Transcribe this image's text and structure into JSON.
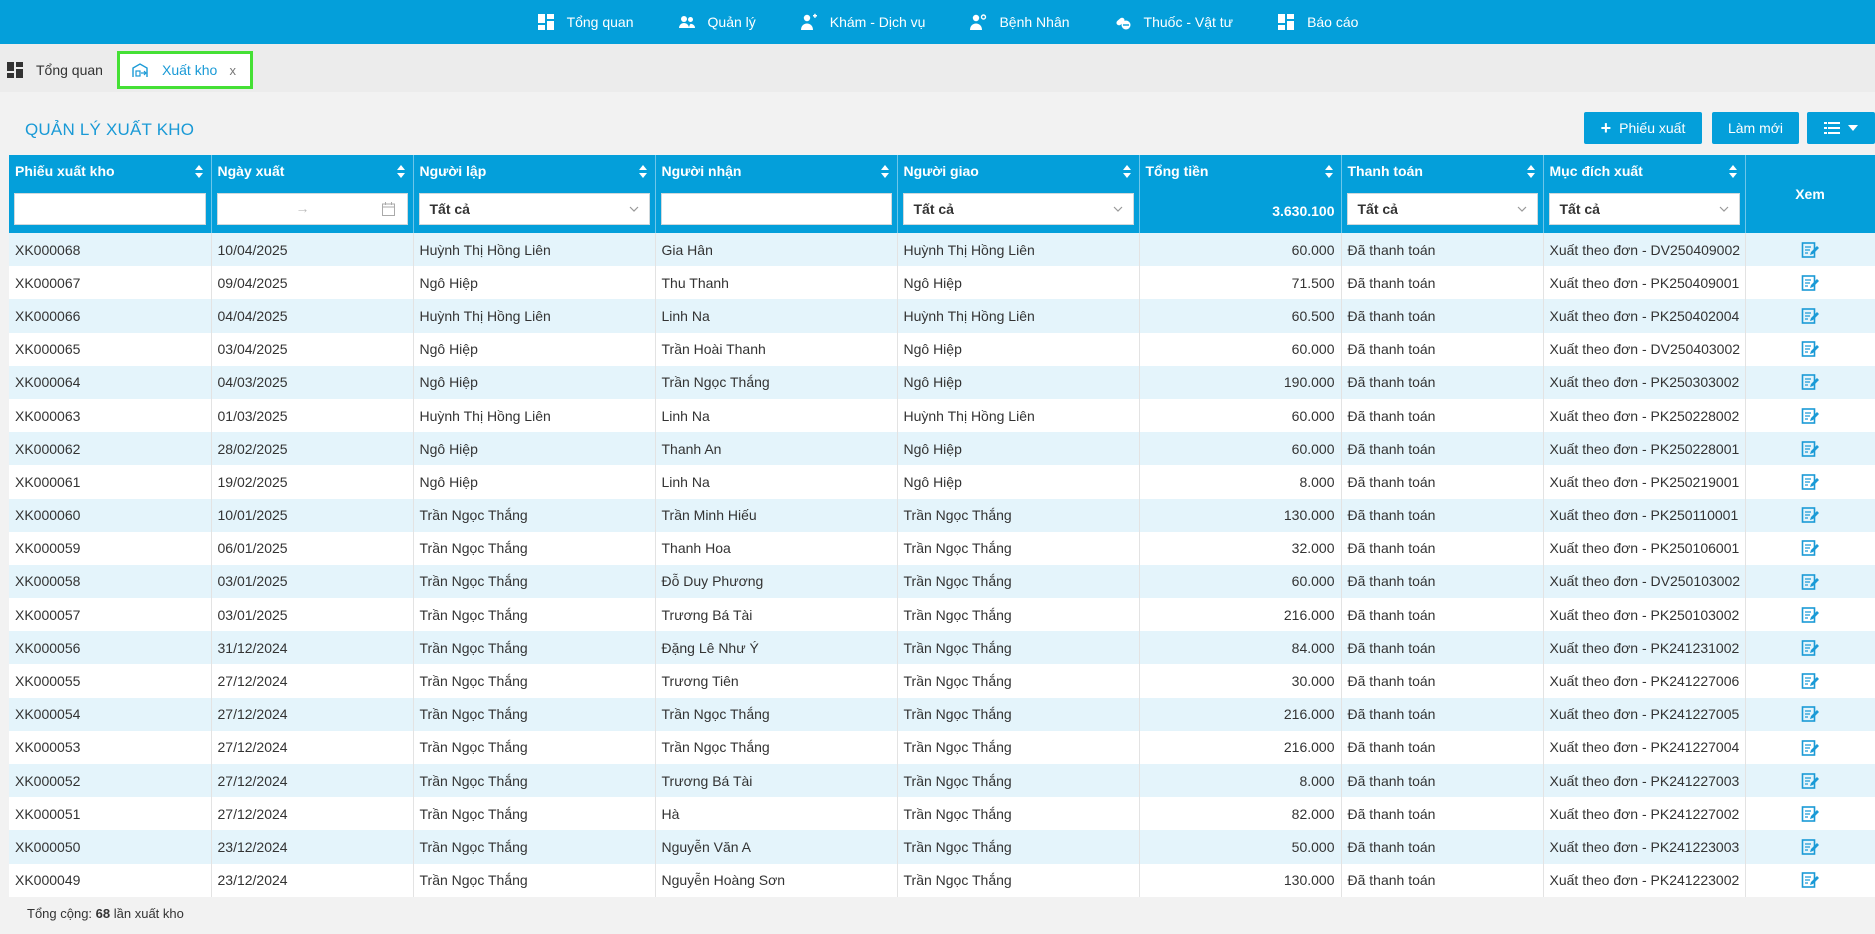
{
  "nav": {
    "items": [
      {
        "label": "Tổng quan",
        "icon": "dashboard-icon"
      },
      {
        "label": "Quản lý",
        "icon": "users-icon"
      },
      {
        "label": "Khám - Dịch vụ",
        "icon": "doctor-icon"
      },
      {
        "label": "Bệnh Nhân",
        "icon": "patient-icon"
      },
      {
        "label": "Thuốc - Vật tư",
        "icon": "medicine-icon"
      },
      {
        "label": "Báo cáo",
        "icon": "report-icon"
      }
    ]
  },
  "tabs": {
    "home": "Tổng quan",
    "active": "Xuất kho",
    "close": "x"
  },
  "panel": {
    "title": "QUẢN LÝ XUẤT KHO",
    "add_button": "Phiếu xuất",
    "refresh_button": "Làm mới"
  },
  "table": {
    "columns": [
      "Phiếu xuất kho",
      "Ngày xuất",
      "Người lập",
      "Người nhận",
      "Người giao",
      "Tổng tiền",
      "Thanh toán",
      "Mục đích xuất",
      "Xem"
    ],
    "filters": {
      "nguoi_lap": "Tất cả",
      "nguoi_giao": "Tất cả",
      "thanh_toan": "Tất cả",
      "muc_dich": "Tất cả",
      "date_separator": "→"
    },
    "total": "3.630.100",
    "rows": [
      [
        "XK000068",
        "10/04/2025",
        "Huỳnh Thị Hồng Liên",
        "Gia Hân",
        "Huỳnh Thị Hồng Liên",
        "60.000",
        "Đã thanh toán",
        "Xuất theo đơn - DV250409002"
      ],
      [
        "XK000067",
        "09/04/2025",
        "Ngô Hiệp",
        "Thu Thanh",
        "Ngô Hiệp",
        "71.500",
        "Đã thanh toán",
        "Xuất theo đơn - PK250409001"
      ],
      [
        "XK000066",
        "04/04/2025",
        "Huỳnh Thị Hồng Liên",
        "Linh Na",
        "Huỳnh Thị Hồng Liên",
        "60.500",
        "Đã thanh toán",
        "Xuất theo đơn - PK250402004"
      ],
      [
        "XK000065",
        "03/04/2025",
        "Ngô Hiệp",
        "Trần Hoài Thanh",
        "Ngô Hiệp",
        "60.000",
        "Đã thanh toán",
        "Xuất theo đơn - DV250403002"
      ],
      [
        "XK000064",
        "04/03/2025",
        "Ngô Hiệp",
        "Trần Ngọc Thắng",
        "Ngô Hiệp",
        "190.000",
        "Đã thanh toán",
        "Xuất theo đơn - PK250303002"
      ],
      [
        "XK000063",
        "01/03/2025",
        "Huỳnh Thị Hồng Liên",
        "Linh Na",
        "Huỳnh Thị Hồng Liên",
        "60.000",
        "Đã thanh toán",
        "Xuất theo đơn - PK250228002"
      ],
      [
        "XK000062",
        "28/02/2025",
        "Ngô Hiệp",
        "Thanh An",
        "Ngô Hiệp",
        "60.000",
        "Đã thanh toán",
        "Xuất theo đơn - PK250228001"
      ],
      [
        "XK000061",
        "19/02/2025",
        "Ngô Hiệp",
        "Linh Na",
        "Ngô Hiệp",
        "8.000",
        "Đã thanh toán",
        "Xuất theo đơn - PK250219001"
      ],
      [
        "XK000060",
        "10/01/2025",
        "Trần Ngọc Thắng",
        "Trần Minh Hiếu",
        "Trần Ngọc Thắng",
        "130.000",
        "Đã thanh toán",
        "Xuất theo đơn - PK250110001"
      ],
      [
        "XK000059",
        "06/01/2025",
        "Trần Ngọc Thắng",
        "Thanh Hoa",
        "Trần Ngọc Thắng",
        "32.000",
        "Đã thanh toán",
        "Xuất theo đơn - PK250106001"
      ],
      [
        "XK000058",
        "03/01/2025",
        "Trần Ngọc Thắng",
        "Đỗ Duy Phương",
        "Trần Ngọc Thắng",
        "60.000",
        "Đã thanh toán",
        "Xuất theo đơn - DV250103002"
      ],
      [
        "XK000057",
        "03/01/2025",
        "Trần Ngọc Thắng",
        "Trương Bá Tài",
        "Trần Ngọc Thắng",
        "216.000",
        "Đã thanh toán",
        "Xuất theo đơn - PK250103002"
      ],
      [
        "XK000056",
        "31/12/2024",
        "Trần Ngọc Thắng",
        "Đặng Lê Như Ý",
        "Trần Ngọc Thắng",
        "84.000",
        "Đã thanh toán",
        "Xuất theo đơn - PK241231002"
      ],
      [
        "XK000055",
        "27/12/2024",
        "Trần Ngọc Thắng",
        "Trương Tiên",
        "Trần Ngọc Thắng",
        "30.000",
        "Đã thanh toán",
        "Xuất theo đơn - PK241227006"
      ],
      [
        "XK000054",
        "27/12/2024",
        "Trần Ngọc Thắng",
        "Trần Ngọc Thắng",
        "Trần Ngọc Thắng",
        "216.000",
        "Đã thanh toán",
        "Xuất theo đơn - PK241227005"
      ],
      [
        "XK000053",
        "27/12/2024",
        "Trần Ngọc Thắng",
        "Trần Ngọc Thắng",
        "Trần Ngọc Thắng",
        "216.000",
        "Đã thanh toán",
        "Xuất theo đơn - PK241227004"
      ],
      [
        "XK000052",
        "27/12/2024",
        "Trần Ngọc Thắng",
        "Trương Bá Tài",
        "Trần Ngọc Thắng",
        "8.000",
        "Đã thanh toán",
        "Xuất theo đơn - PK241227003"
      ],
      [
        "XK000051",
        "27/12/2024",
        "Trần Ngọc Thắng",
        "Hà",
        "Trần Ngọc Thắng",
        "82.000",
        "Đã thanh toán",
        "Xuất theo đơn - PK241227002"
      ],
      [
        "XK000050",
        "23/12/2024",
        "Trần Ngọc Thắng",
        "Nguyễn Văn A",
        "Trần Ngọc Thắng",
        "50.000",
        "Đã thanh toán",
        "Xuất theo đơn - PK241223003"
      ],
      [
        "XK000049",
        "23/12/2024",
        "Trần Ngọc Thắng",
        "Nguyễn Hoàng Sơn",
        "Trần Ngọc Thắng",
        "130.000",
        "Đã thanh toán",
        "Xuất theo đơn - PK241223002"
      ]
    ]
  },
  "footer": {
    "prefix": "Tổng cộng:",
    "count": "68",
    "suffix": "lần xuất kho"
  },
  "colors": {
    "primary": "#049fda",
    "title": "#1a9ad6",
    "row_alt": "#e4f4fb",
    "active_tab_border": "#45e035"
  }
}
